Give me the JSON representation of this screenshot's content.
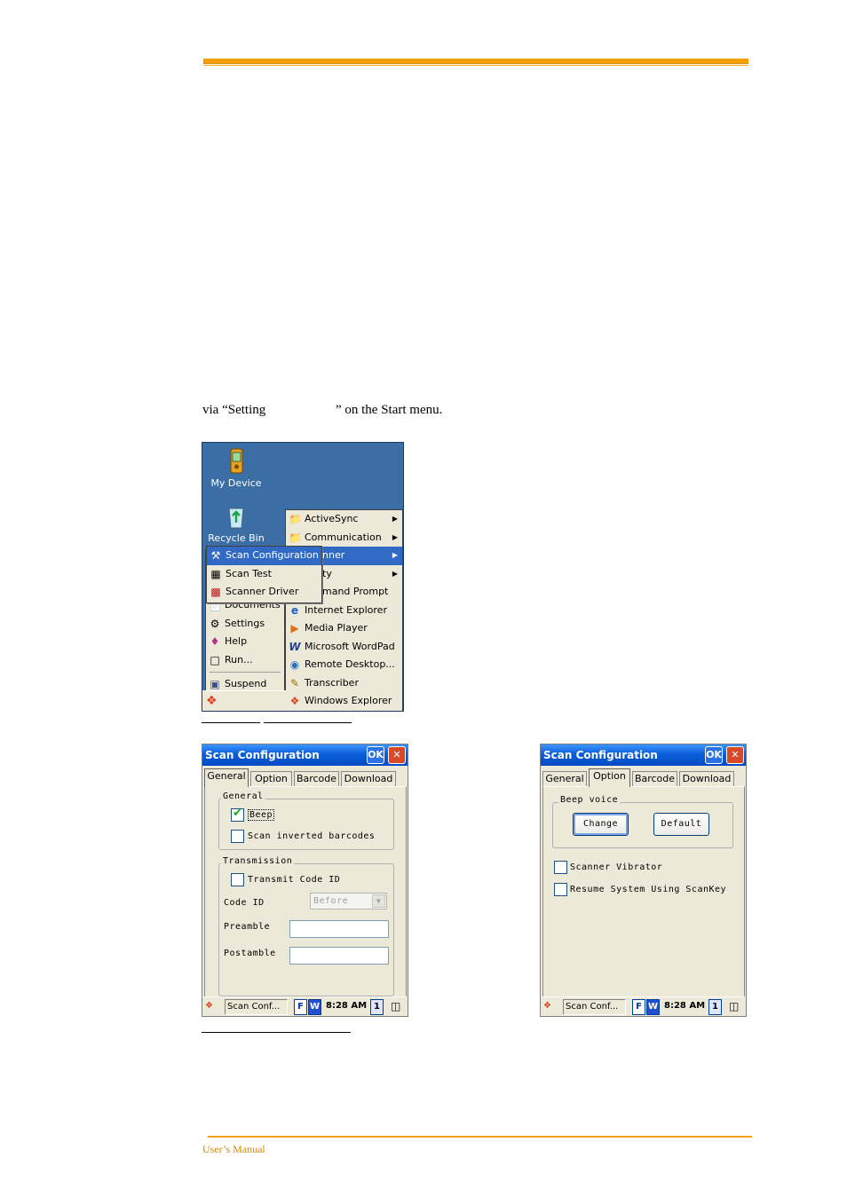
{
  "body_text": "via “Setting                     ” on the Start menu.",
  "footer": {
    "text": "User’s Manual"
  },
  "desktop": {
    "icons": [
      {
        "label": "My Device",
        "icon": "device-icon"
      },
      {
        "label": "Recycle Bin",
        "icon": "recycle-bin-icon"
      }
    ],
    "start_menu": {
      "items": [
        {
          "label": "Settings",
          "icon": "settings-icon"
        },
        {
          "label": "Help",
          "icon": "help-book-icon"
        },
        {
          "label": "Run...",
          "icon": "run-icon"
        },
        {
          "label": "Suspend",
          "icon": "suspend-icon"
        }
      ],
      "hidden_partial": "Documents"
    },
    "programs_menu": {
      "items": [
        {
          "label": "ActiveSync",
          "icon": "folder-icon",
          "submenu": true
        },
        {
          "label": "Communication",
          "icon": "folder-icon",
          "submenu": true
        },
        {
          "label": "nner",
          "icon": "",
          "submenu": true,
          "selected": true
        },
        {
          "label": "ty",
          "icon": "",
          "submenu": true
        },
        {
          "label": "mand Prompt",
          "icon": ""
        },
        {
          "label": "Internet Explorer",
          "icon": "ie-icon"
        },
        {
          "label": "Media Player",
          "icon": "media-player-icon"
        },
        {
          "label": "Microsoft WordPad",
          "icon": "wordpad-icon"
        },
        {
          "label": "Remote Desktop...",
          "icon": "remote-desktop-icon"
        },
        {
          "label": "Transcriber",
          "icon": "transcriber-icon"
        },
        {
          "label": "Windows Explorer",
          "icon": "windows-explorer-icon"
        }
      ]
    },
    "scanner_menu": {
      "items": [
        {
          "label": "Scan Configuration",
          "icon": "scan-config-icon",
          "selected": true
        },
        {
          "label": "Scan Test",
          "icon": "scan-test-icon"
        },
        {
          "label": "Scanner Driver",
          "icon": "scanner-driver-icon"
        }
      ]
    }
  },
  "dialog_general": {
    "title": "Scan Configuration",
    "ok": "OK",
    "close": "✕",
    "tabs": [
      "General",
      "Option",
      "Barcode",
      "Download"
    ],
    "group_general": "General",
    "beep": "Beep",
    "scan_inverted": "Scan inverted barcodes",
    "group_transmission": "Transmission",
    "transmit_code_id": "Transmit Code ID",
    "code_id_label": "Code ID",
    "code_id_value": "Before",
    "preamble": "Preamble",
    "postamble": "Postamble",
    "taskbar": {
      "task": "Scan Conf...",
      "f": "F",
      "w": "W",
      "time": "8:28 AM",
      "num": "1"
    }
  },
  "dialog_option": {
    "title": "Scan Configuration",
    "ok": "OK",
    "close": "✕",
    "tabs": [
      "General",
      "Option",
      "Barcode",
      "Download"
    ],
    "group_beep": "Beep voice",
    "change": "Change",
    "default": "Default",
    "vibrator": "Scanner Vibrator",
    "resume": "Resume System Using ScanKey",
    "taskbar": {
      "task": "Scan Conf...",
      "f": "F",
      "w": "W",
      "time": "8:28 AM",
      "num": "1"
    }
  }
}
